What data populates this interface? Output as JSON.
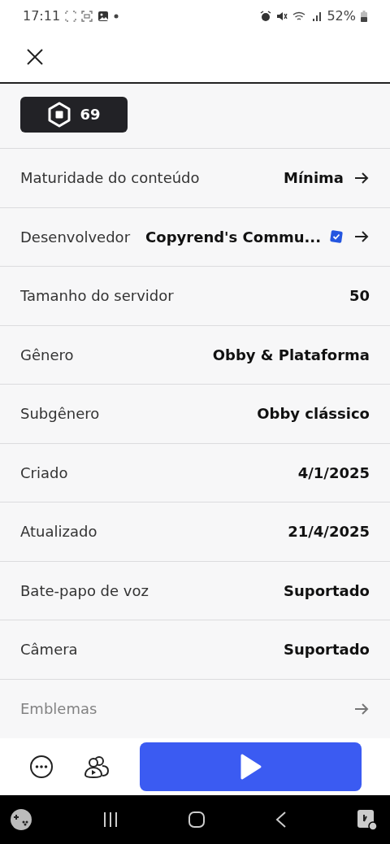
{
  "status_bar": {
    "time": "17:11",
    "battery": "52%"
  },
  "robux_badge": {
    "amount": "69"
  },
  "details": [
    {
      "label": "Maturidade do conteúdo",
      "value": "Mínima",
      "verified": false,
      "arrow": true
    },
    {
      "label": "Desenvolvedor",
      "value": "Copyrend's Commu...",
      "verified": true,
      "arrow": true
    },
    {
      "label": "Tamanho do servidor",
      "value": "50",
      "verified": false,
      "arrow": false
    },
    {
      "label": "Gênero",
      "value": "Obby & Plataforma",
      "verified": false,
      "arrow": false
    },
    {
      "label": "Subgênero",
      "value": "Obby clássico",
      "verified": false,
      "arrow": false
    },
    {
      "label": "Criado",
      "value": "4/1/2025",
      "verified": false,
      "arrow": false
    },
    {
      "label": "Atualizado",
      "value": "21/4/2025",
      "verified": false,
      "arrow": false
    },
    {
      "label": "Bate-papo de voz",
      "value": "Suportado",
      "verified": false,
      "arrow": false
    },
    {
      "label": "Câmera",
      "value": "Suportado",
      "verified": false,
      "arrow": false
    },
    {
      "label": "Emblemas",
      "verified": false,
      "arrow": true
    }
  ]
}
